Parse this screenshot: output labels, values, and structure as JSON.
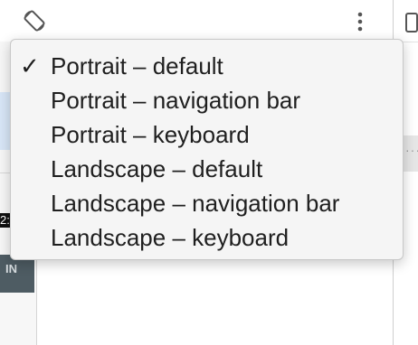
{
  "toolbar": {
    "rotate_icon": "rotate-device-icon",
    "more_icon": "kebab-menu-icon"
  },
  "menu": {
    "selected_index": 0,
    "items": [
      {
        "label": "Portrait – default",
        "checked": true
      },
      {
        "label": "Portrait – navigation bar",
        "checked": false
      },
      {
        "label": "Portrait – keyboard",
        "checked": false
      },
      {
        "label": "Landscape – default",
        "checked": false
      },
      {
        "label": "Landscape – navigation bar",
        "checked": false
      },
      {
        "label": "Landscape – keyboard",
        "checked": false
      }
    ],
    "check_glyph": "✓"
  },
  "preview": {
    "time_text": "2:",
    "button_text": "IN"
  }
}
